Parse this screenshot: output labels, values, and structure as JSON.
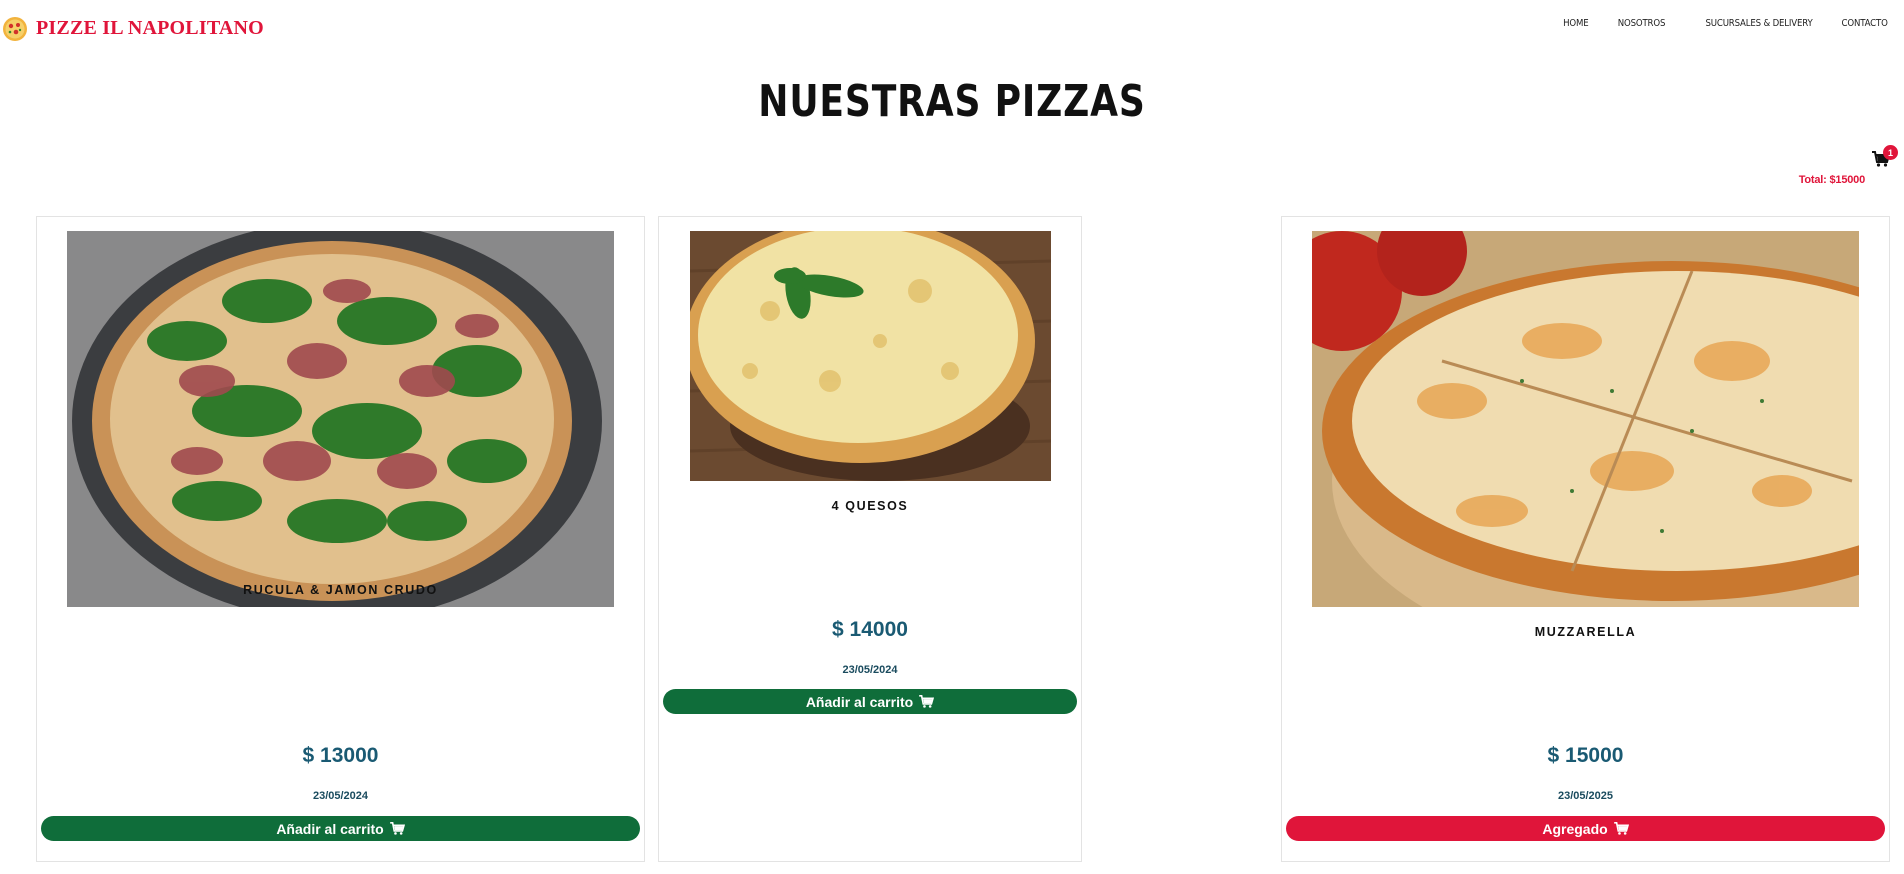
{
  "brand": {
    "name": "PIZZE IL NAPOLITANO",
    "logo_icon": "pizza-logo-icon"
  },
  "nav": {
    "items": [
      "HOME",
      "NOSOTROS",
      "SUCURSALES & DELIVERY",
      "CONTACTO"
    ]
  },
  "page": {
    "title": "NUESTRAS PIZZAS"
  },
  "cart": {
    "icon": "shopping-cart-icon",
    "count": "1",
    "total": "Total: $15000"
  },
  "products": [
    {
      "name": "RUCULA & JAMON CRUDO",
      "price": "$ 13000",
      "date": "23/05/2024",
      "button": "Añadir al carrito",
      "button_state": "add",
      "image": "pizza-rucula-photo"
    },
    {
      "name": "4 QUESOS",
      "price": "$ 14000",
      "date": "23/05/2024",
      "button": "Añadir al carrito",
      "button_state": "add",
      "image": "pizza-4-quesos-photo"
    },
    {
      "name": "MUZZARELLA",
      "price": "$ 15000",
      "date": "23/05/2025",
      "button": "Agregado",
      "button_state": "added",
      "image": "pizza-muzzarella-photo"
    }
  ],
  "colors": {
    "accent_red": "#e0153a",
    "button_green": "#0f6d3a",
    "price_blue": "#1a5a73"
  }
}
